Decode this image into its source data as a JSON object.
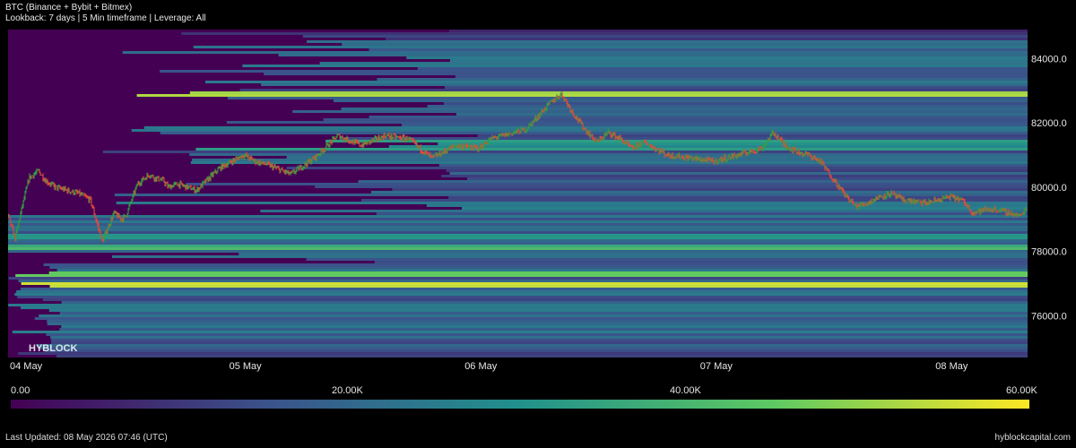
{
  "header": {
    "title": "BTC (Binance + Bybit + Bitmex)",
    "subtitle": "Lookback: 7 days | 5 Min timeframe | Leverage: All"
  },
  "watermark": "HYBLOCK",
  "colorbar": {
    "labels": [
      "0.00",
      "20.00K",
      "40.00K",
      "60.00K"
    ],
    "min": 0,
    "max": 60000,
    "colors": [
      "#440154",
      "#3b528b",
      "#21918c",
      "#5ec962",
      "#fde725"
    ]
  },
  "footer": {
    "last_updated": "Last Updated: 08 May 2026 07:46 (UTC)",
    "site": "hyblockcapital.com"
  },
  "chart_data": {
    "type": "heatmap",
    "x_ticks": [
      "04 May",
      "05 May",
      "06 May",
      "07 May",
      "08 May"
    ],
    "y_ticks": [
      "84000.0",
      "82000.0",
      "80000.0",
      "78000.0",
      "76000.0"
    ],
    "y_tick_values": [
      84000,
      82000,
      80000,
      78000,
      76000
    ],
    "ylim": [
      74700,
      84900
    ],
    "xlim_days": [
      0,
      4.33
    ],
    "candle_color_up": "#2ea043",
    "candle_color_down": "#e8483b",
    "price_series": {
      "t_days": [
        0.0,
        0.03,
        0.06,
        0.09,
        0.13,
        0.16,
        0.2,
        0.25,
        0.3,
        0.35,
        0.4,
        0.45,
        0.48,
        0.5,
        0.55,
        0.6,
        0.62,
        0.66,
        0.68,
        0.72,
        0.8,
        0.9,
        1.0,
        1.05,
        1.1,
        1.2,
        1.3,
        1.4,
        1.5,
        1.6,
        1.7,
        1.75,
        1.8,
        1.9,
        2.0,
        2.05,
        2.1,
        2.2,
        2.3,
        2.35,
        2.4,
        2.45,
        2.5,
        2.55,
        2.6,
        2.65,
        2.7,
        2.8,
        2.9,
        3.0,
        3.1,
        3.2,
        3.25,
        3.3,
        3.35,
        3.4,
        3.45,
        3.5,
        3.55,
        3.6,
        3.65,
        3.7,
        3.75,
        3.8,
        3.9,
        4.0,
        4.05,
        4.1,
        4.15,
        4.2,
        4.3,
        4.33
      ],
      "price": [
        79100,
        78400,
        79400,
        80300,
        80500,
        80200,
        80000,
        79900,
        79800,
        79600,
        78300,
        79200,
        79000,
        79100,
        80100,
        80400,
        80300,
        80200,
        80000,
        80100,
        79900,
        80600,
        81000,
        80800,
        80700,
        80400,
        80900,
        81600,
        81300,
        81600,
        81500,
        81200,
        80900,
        81300,
        81200,
        81500,
        81600,
        81800,
        82600,
        82900,
        82300,
        81800,
        81400,
        81700,
        81500,
        81200,
        81400,
        81000,
        80900,
        80800,
        81000,
        81200,
        81700,
        81300,
        81100,
        81000,
        80800,
        80300,
        79800,
        79400,
        79500,
        79700,
        79800,
        79600,
        79500,
        79700,
        79600,
        79200,
        79300,
        79300,
        79100,
        79400
      ]
    }
  }
}
